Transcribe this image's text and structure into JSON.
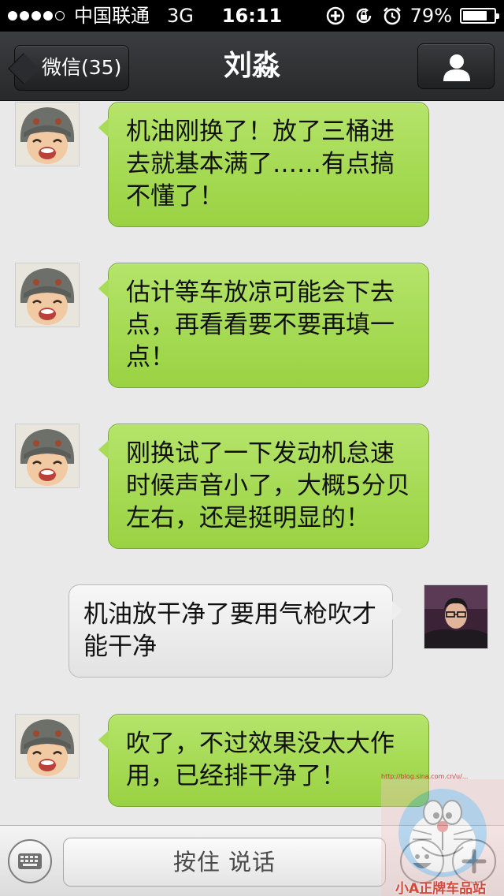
{
  "status_bar": {
    "carrier": "中国联通",
    "network": "3G",
    "time": "16:11",
    "battery": "79%",
    "battery_level": 0.79
  },
  "nav": {
    "back_label": "微信(35)",
    "title": "刘淼"
  },
  "messages": [
    {
      "from": "them",
      "text": "机油刚换了！放了三桶进去就基本满了……有点搞不懂了！"
    },
    {
      "from": "them",
      "text": "估计等车放凉可能会下去点，再看看要不要再填一点！"
    },
    {
      "from": "them",
      "text": "刚换试了一下发动机怠速时候声音小了，大概5分贝左右，还是挺明显的！"
    },
    {
      "from": "me",
      "text": "机油放干净了要用气枪吹才能干净"
    },
    {
      "from": "them",
      "text": "吹了，不过效果没太大作用，已经排干净了！"
    }
  ],
  "toolbar": {
    "talk_label": "按住 说话"
  },
  "watermark": {
    "url": "http://blog.sina.com.cn/u/...",
    "caption": "小A正牌车品站"
  },
  "colors": {
    "incoming_bubble": "#a8dc56",
    "outgoing_bubble": "#eeeeee",
    "nav_bar": "#2f3134",
    "chat_background": "#e9e9e9"
  }
}
